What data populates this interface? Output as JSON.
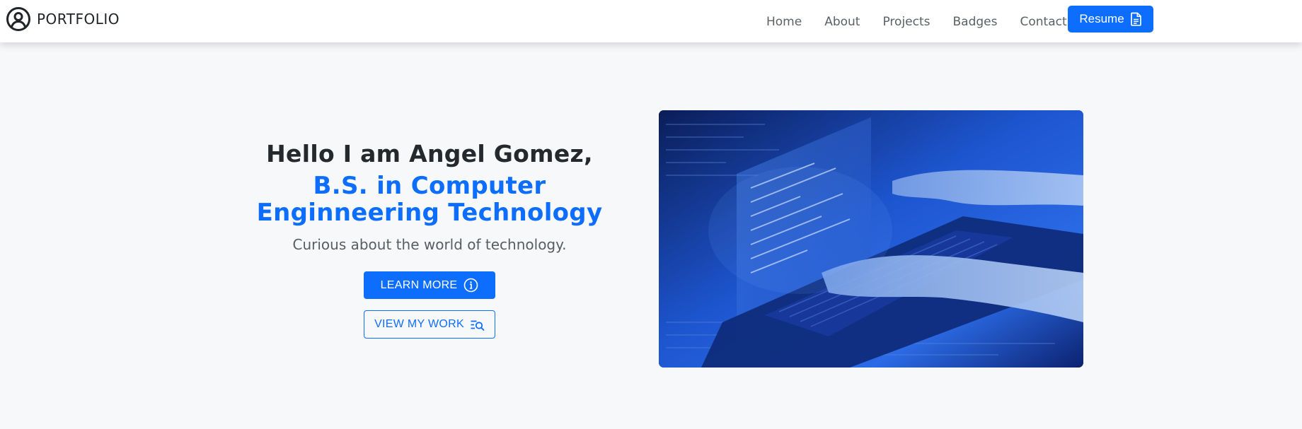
{
  "brand": {
    "icon": "user-circle-icon",
    "name": "PORTFOLIO"
  },
  "nav": {
    "links": [
      "Home",
      "About",
      "Projects",
      "Badges",
      "Contact"
    ],
    "resume_label": "Resume",
    "resume_icon": "file-text-icon"
  },
  "hero": {
    "greeting": "Hello I am Angel Gomez,",
    "degree": "B.S. in Computer Enginneering Technology",
    "tagline": "Curious about the world of technology.",
    "learn_more_label": "LEARN MORE",
    "learn_more_icon": "info-circle-icon",
    "view_work_label": "VIEW MY WORK",
    "view_work_icon": "list-search-icon",
    "image_subject": "hands typing on laptop with code overlay"
  },
  "colors": {
    "accent": "#0d6efd",
    "heading": "#25282c",
    "muted": "#585d63",
    "background": "#f7f8fa"
  }
}
